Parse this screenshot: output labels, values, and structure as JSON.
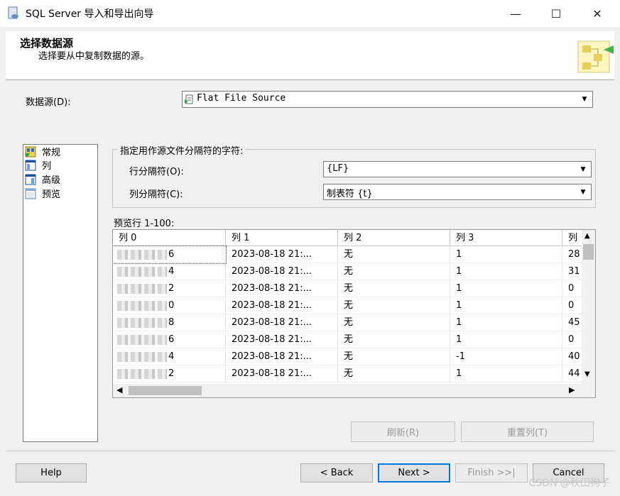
{
  "window": {
    "title": "SQL Server 导入和导出向导",
    "minimize": "—",
    "maximize": "☐",
    "close": "✕"
  },
  "header": {
    "title": "选择数据源",
    "subtitle": "选择要从中复制数据的源。"
  },
  "datasource": {
    "label": "数据源(D):",
    "value": "Flat File Source"
  },
  "nav": {
    "items": [
      {
        "label": "常规",
        "icon": "general-icon"
      },
      {
        "label": "列",
        "icon": "columns-icon"
      },
      {
        "label": "高级",
        "icon": "advanced-icon"
      },
      {
        "label": "预览",
        "icon": "preview-icon"
      }
    ]
  },
  "delimiters": {
    "legend": "指定用作源文件分隔符的字符:",
    "row_label": "行分隔符(O):",
    "row_value": "{LF}",
    "col_label": "列分隔符(C):",
    "col_value": "制表符 {t}"
  },
  "preview": {
    "label": "预览行 1-100:",
    "columns": [
      "列 0",
      "列 1",
      "列 2",
      "列 3",
      "列"
    ],
    "rows": [
      [
        "6",
        "2023-08-18 21:...",
        "无",
        "1",
        "28"
      ],
      [
        "4",
        "2023-08-18 21:...",
        "无",
        "1",
        "31"
      ],
      [
        "2",
        "2023-08-18 21:...",
        "无",
        "1",
        "0"
      ],
      [
        "0",
        "2023-08-18 21:...",
        "无",
        "1",
        "0"
      ],
      [
        "8",
        "2023-08-18 21:...",
        "无",
        "1",
        "45"
      ],
      [
        "6",
        "2023-08-18 21:...",
        "无",
        "1",
        "0"
      ],
      [
        "4",
        "2023-08-18 21:...",
        "无",
        "-1",
        "40"
      ],
      [
        "2",
        "2023-08-18 21:...",
        "无",
        "1",
        "44"
      ]
    ]
  },
  "buttons": {
    "refresh": "刷新(R)",
    "reset": "重置列(T)",
    "help": "Help",
    "back": "< Back",
    "next": "Next >",
    "finish": "Finish >>|",
    "cancel": "Cancel"
  },
  "watermark": "CSDN @秋田狗子"
}
